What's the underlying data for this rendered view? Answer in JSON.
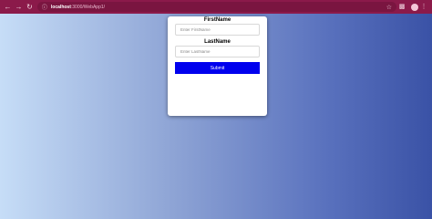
{
  "browser": {
    "url_host": "localhost",
    "url_path": ":3000/WebApp1/",
    "toolbar_color": "#8b1a4a"
  },
  "form": {
    "first_name_label": "FirstName",
    "first_name_placeholder": "Enter FirstName",
    "last_name_label": "LastName",
    "last_name_placeholder": "Enter LastName",
    "submit_label": "Submit",
    "submit_color": "#0000ee"
  }
}
